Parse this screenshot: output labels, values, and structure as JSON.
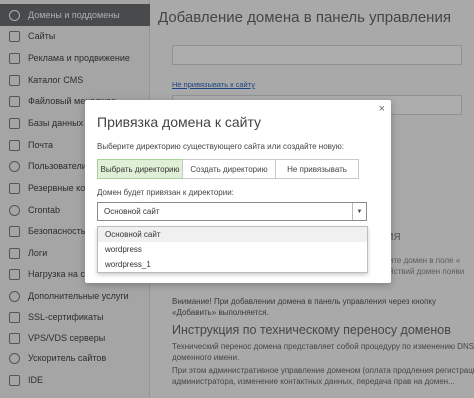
{
  "sidebar": {
    "items": [
      {
        "label": "Домены и поддомены",
        "icon": "globe-icon"
      },
      {
        "label": "Сайты",
        "icon": "folder-icon"
      },
      {
        "label": "Реклама и продвижение",
        "icon": "megaphone-icon"
      },
      {
        "label": "Каталог CMS",
        "icon": "cms-icon"
      },
      {
        "label": "Файловый менеджер",
        "icon": "file-manager-icon"
      },
      {
        "label": "Базы данных My",
        "icon": "database-icon"
      },
      {
        "label": "Почта",
        "icon": "mail-icon"
      },
      {
        "label": "Пользователи П",
        "icon": "users-icon"
      },
      {
        "label": "Резервные копии",
        "icon": "backup-icon"
      },
      {
        "label": "Crontab",
        "icon": "clock-icon"
      },
      {
        "label": "Безопасность",
        "icon": "shield-icon"
      },
      {
        "label": "Логи",
        "icon": "logs-icon"
      },
      {
        "label": "Нагрузка на сер",
        "icon": "load-icon"
      },
      {
        "label": "Дополнительные услуги",
        "icon": "services-icon"
      },
      {
        "label": "SSL-сертификаты",
        "icon": "ssl-icon"
      },
      {
        "label": "VPS/VDS серверы",
        "icon": "server-icon"
      },
      {
        "label": "Ускоритель сайтов",
        "icon": "accelerator-icon"
      },
      {
        "label": "IDE",
        "icon": "ide-icon"
      }
    ]
  },
  "main": {
    "title": "Добавление домена в панель управления",
    "no_bind_link": "Не привязывать к сайту",
    "partial_heading": "ания",
    "right_text_1": "оните домен в поле «",
    "right_text_2": "действий домен появи",
    "warning": "Внимание! При добавлении домена в панель управления через кнопку «Добавить» выполняется.",
    "section_heading": "Инструкция по техническому переносу доменов",
    "paragraphs": [
      "Технический перенос домена представляет собой процедуру по изменению DNS-",
      "доменного имени.",
      "При этом административное управление доменом (оплата продления регистрации",
      "администратора, изменение контактных данных, передача прав на домен..."
    ]
  },
  "modal": {
    "title": "Привязка домена к сайту",
    "close": "×",
    "choose_label": "Выберите директорию существующего сайта или создайте новую:",
    "options": [
      "Выбрать директорию",
      "Создать директорию",
      "Не привязывать"
    ],
    "active_option": 0,
    "bind_label": "Домен будет привязан к директории:",
    "select_value": "Основной сайт",
    "dropdown_options": [
      "Основной сайт",
      "wordpress",
      "wordpress_1"
    ]
  }
}
